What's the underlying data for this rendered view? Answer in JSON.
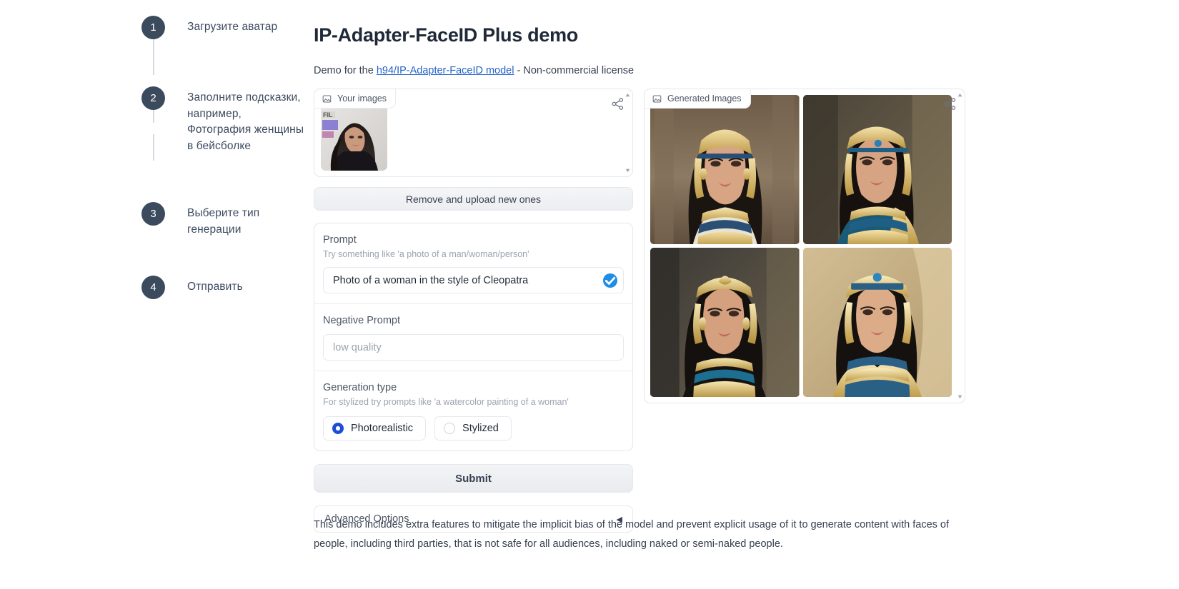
{
  "steps": [
    {
      "number": "1",
      "label": "Загрузите аватар"
    },
    {
      "number": "2",
      "label": "Заполните подсказки, например, Фотография женщины в бейсболке"
    },
    {
      "number": "3",
      "label": "Выберите тип генерации"
    },
    {
      "number": "4",
      "label": "Отправить"
    }
  ],
  "header": {
    "title": "IP-Adapter-FaceID Plus demo",
    "subtitle_prefix": "Demo for the ",
    "link_text": "h94/IP-Adapter-FaceID model",
    "subtitle_suffix": " - Non-commercial license"
  },
  "upload": {
    "panel_label": "Your images",
    "remove_label": "Remove and upload new ones"
  },
  "prompt": {
    "label": "Prompt",
    "hint": "Try something like 'a photo of a man/woman/person'",
    "value": "Photo of a woman in the style of Cleopatra"
  },
  "negative_prompt": {
    "label": "Negative Prompt",
    "placeholder": "low quality",
    "value": ""
  },
  "generation_type": {
    "label": "Generation type",
    "hint": "For stylized try prompts like 'a watercolor painting of a woman'",
    "options": [
      {
        "label": "Photorealistic",
        "selected": true
      },
      {
        "label": "Stylized",
        "selected": false
      }
    ]
  },
  "actions": {
    "submit_label": "Submit",
    "advanced_label": "Advanced Options",
    "advanced_caret": "◀"
  },
  "generated": {
    "panel_label": "Generated Images",
    "count": 4
  },
  "disclaimer": "This demo includes extra features to mitigate the implicit bias of the model and prevent explicit usage of it to generate content with faces of people, including third parties, that is not safe for all audiences, including naked or semi-naked people.",
  "colors": {
    "step_badge": "#3c4a5e",
    "link": "#2563c9",
    "radio_selected": "#1d4ed8",
    "check_badge": "#1f8ce6"
  }
}
